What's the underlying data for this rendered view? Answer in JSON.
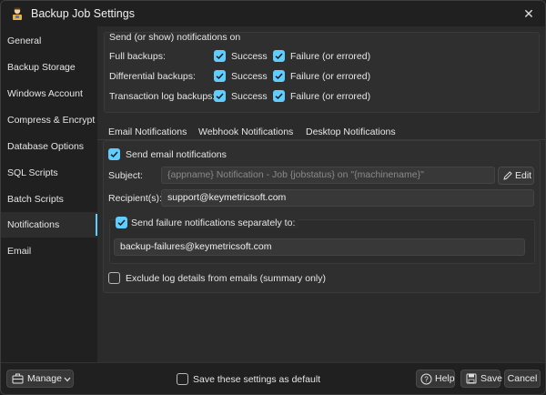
{
  "window": {
    "title": "Backup Job Settings"
  },
  "sidebar": {
    "items": [
      {
        "label": "General"
      },
      {
        "label": "Backup Storage"
      },
      {
        "label": "Windows Account"
      },
      {
        "label": "Compress & Encrypt"
      },
      {
        "label": "Database Options"
      },
      {
        "label": "SQL Scripts"
      },
      {
        "label": "Batch Scripts"
      },
      {
        "label": "Notifications",
        "active": true
      },
      {
        "label": "Email"
      }
    ]
  },
  "notify_on": {
    "legend": "Send (or show) notifications on",
    "rows": [
      {
        "label": "Full backups:",
        "success": "Success",
        "failure": "Failure (or errored)",
        "success_checked": true,
        "failure_checked": true
      },
      {
        "label": "Differential backups:",
        "success": "Success",
        "failure": "Failure (or errored)",
        "success_checked": true,
        "failure_checked": true
      },
      {
        "label": "Transaction log backups:",
        "success": "Success",
        "failure": "Failure (or errored)",
        "success_checked": true,
        "failure_checked": true
      }
    ]
  },
  "tabs": [
    {
      "label": "Email Notifications",
      "active": true
    },
    {
      "label": "Webhook Notifications"
    },
    {
      "label": "Desktop Notifications"
    }
  ],
  "email": {
    "send_label": "Send email notifications",
    "send_checked": true,
    "subject_label": "Subject:",
    "subject_value": "{appname} Notification - Job {jobstatus} on \"{machinename}\"",
    "edit_label": "Edit",
    "recipients_label": "Recipient(s):",
    "recipients_value": "support@keymetricsoft.com",
    "separate_label": "Send failure notifications separately to:",
    "separate_checked": true,
    "separate_value": "backup-failures@keymetricsoft.com",
    "exclude_label": "Exclude log details from emails (summary only)",
    "exclude_checked": false
  },
  "footer": {
    "manage_label": "Manage",
    "default_label": "Save these settings as default",
    "default_checked": false,
    "help_label": "Help",
    "save_label": "Save",
    "cancel_label": "Cancel"
  },
  "colors": {
    "accent": "#60cdff",
    "background": "#2b2b2b",
    "sidebar": "#202020"
  }
}
